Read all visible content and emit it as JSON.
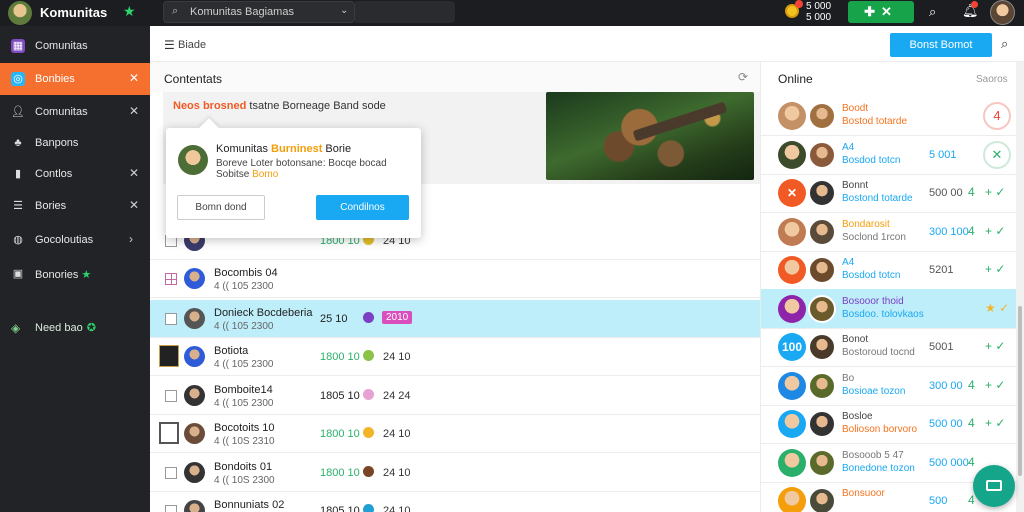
{
  "topbar": {
    "brand": "Komunitas",
    "search_text": "Komunitas Bagiamas",
    "coin_line1": "5 000",
    "coin_line2": "5 000",
    "game_button": "✕"
  },
  "sidebar": {
    "items": [
      {
        "label": "Comunitas",
        "icon": "grid-icon",
        "close": false
      },
      {
        "label": "Bonbies",
        "icon": "bell-icon",
        "close": true,
        "active": true
      },
      {
        "label": "Comunitas",
        "icon": "users-icon",
        "close": true
      },
      {
        "label": "Banpons",
        "icon": "group-icon",
        "close": false
      },
      {
        "label": "Contlos",
        "icon": "book-icon",
        "close": true
      },
      {
        "label": "Bories",
        "icon": "list-icon",
        "close": true
      },
      {
        "label": "Gocoloutias",
        "icon": "globe-icon",
        "close": true,
        "chevron": true
      },
      {
        "label": "Bonories",
        "icon": "box-icon",
        "close": false,
        "star": true
      }
    ],
    "footer": {
      "label": "Need bao",
      "icon": "shield-icon"
    }
  },
  "toolbar": {
    "menu_label": "Biade",
    "primary_button": "Bonst Bomot"
  },
  "content": {
    "title": "Contentats",
    "banner_highlight": "Neos brosned",
    "banner_text": " tsatne Borneage Band sode"
  },
  "popup": {
    "title_pre": "Komunitas ",
    "title_hl": "Burninest",
    "title_post": " Borie",
    "line1": "Boreve Loter botonsane: Bocqe bocad",
    "line2_pre": "Sobitse ",
    "line2_hl": "Bomo",
    "secondary": "Bomn dond",
    "primary": "Condilnos"
  },
  "rows": [
    {
      "name": "",
      "sub": "",
      "num": "1800 10",
      "num_color": "#2bb06b",
      "dot": "#e4c02a",
      "val": "24 10",
      "avatar": "#3b3b6b"
    },
    {
      "name": "Bocombis 04",
      "sub": "4 (( 105 2300",
      "num": "",
      "num_color": "#2bb06b",
      "dot": "",
      "val": "",
      "avatar": "#2f5bd8",
      "checkbox_style": "grid"
    },
    {
      "name": "Donieck Bocdeberia",
      "sub": "4 (( 105 2300",
      "num": "25 10",
      "num_color": "#222",
      "dot": "#7a3fc2",
      "pill": "2010",
      "avatar": "#555",
      "selected": true
    },
    {
      "name": "Botiota",
      "sub": "4 (( 105 2300",
      "num": "1800 10",
      "num_color": "#2bb06b",
      "dot": "#8bc34a",
      "val": "24 10",
      "avatar": "#2f5bd8",
      "checkbox_style": "dark"
    },
    {
      "name": "Bomboite14",
      "sub": "4 (( 105 2300",
      "num": "1805 10",
      "num_color": "#222",
      "dot": "#e7a1d3",
      "val": "24 24",
      "avatar": "#333"
    },
    {
      "name": "Bocotoits 10",
      "sub": "4 (( 10S 2310",
      "num": "1800 10",
      "num_color": "#2bb06b",
      "dot": "#f2b52a",
      "val": "24 10",
      "avatar": "#6b4b3a",
      "checkbox_style": "grey"
    },
    {
      "name": "Bondoits 01",
      "sub": "4 (( 10S 2300",
      "num": "1800 10",
      "num_color": "#2bb06b",
      "dot": "#7a4526",
      "val": "24 10",
      "avatar": "#333"
    },
    {
      "name": "Bonnuniats 02",
      "sub": "4 (( 105 2300",
      "num": "1805 10",
      "num_color": "#222",
      "dot": "#1f9fd3",
      "val": "24 10",
      "avatar": "#444"
    }
  ],
  "online": {
    "title": "Online",
    "right_label": "Saoros",
    "rows": [
      {
        "a1": "",
        "a1_color": "#c49066",
        "a2": "#a07040",
        "n1": "Boodt",
        "n1_color": "#f5731f",
        "n2": "Bostod totarde",
        "n2_color": "#f5731f",
        "num": "",
        "num_color": "#19a8f2",
        "ring": "4",
        "ring_color": "#f44336"
      },
      {
        "a1": "",
        "a1_color": "#3b4b2b",
        "a2": "#8a5a3a",
        "n1": "A4",
        "n1_color": "#19a8f2",
        "n2": "Bosdod totcn",
        "n2_color": "#19a8f2",
        "num": "5 001",
        "num_color": "#19a8f2",
        "ring": "✕",
        "ring_color": "#2bb06b"
      },
      {
        "a1": "✕",
        "a1_color": "#f15a24",
        "a2": "#333",
        "n1": "Bonnt",
        "n1_color": "#444",
        "n2": "Bostond totarde",
        "n2_color": "#19a8f2",
        "num": "500 00",
        "num_color": "#555",
        "act1": "4",
        "act2": "+ ✓"
      },
      {
        "a1": "",
        "a1_color": "#c07b52",
        "a2": "#5a4a3a",
        "n1": "Bondarosit",
        "n1_color": "#f59e0b",
        "n2": "Soclond 1rcon",
        "n2_color": "#777",
        "num": "300 100",
        "num_color": "#19a8f2",
        "act1": "4",
        "act2": "+ ✓"
      },
      {
        "a1": "",
        "a1_color": "#f15a24",
        "a2": "#6b4b2b",
        "n1": "A4",
        "n1_color": "#19a8f2",
        "n2": "Bosdod totcn",
        "n2_color": "#19a8f2",
        "num": "5201",
        "num_color": "#555",
        "act2": "+ ✓"
      },
      {
        "a1": "",
        "a1_color": "#8e24aa",
        "a2": "#6b5a2b",
        "n1": "Bosooor thoid",
        "n1_color": "#7a3fc2",
        "n2": "Bosdoo. tolovkaos",
        "n2_color": "#19a8f2",
        "num": "",
        "num_color": "#555",
        "act2": "★ ✓",
        "selected": true
      },
      {
        "a1": "100",
        "a1_color": "#19a8f2",
        "a2": "#4a3a2a",
        "n1": "Bonot",
        "n1_color": "#444",
        "n2": "Bostoroud tocnd",
        "n2_color": "#777",
        "num": "5001",
        "num_color": "#555",
        "act2": "+ ✓"
      },
      {
        "a1": "",
        "a1_color": "#1e88e5",
        "a2": "#5a6a2a",
        "n1": "Bo",
        "n1_color": "#777",
        "n2": "Bosioae tozon",
        "n2_color": "#19a8f2",
        "num": "300 00",
        "num_color": "#19a8f2",
        "act1": "4",
        "act2": "+ ✓"
      },
      {
        "a1": "",
        "a1_color": "#19a8f2",
        "a2": "#333",
        "n1": "Bosloe",
        "n1_color": "#444",
        "n2": "Bolioson borvoro",
        "n2_color": "#f5731f",
        "num": "500 00",
        "num_color": "#19a8f2",
        "act1": "4",
        "act2": "+ ✓"
      },
      {
        "a1": "",
        "a1_color": "#2bb06b",
        "a2": "#5a6a2a",
        "n1": "Bosooob 5 47",
        "n1_color": "#777",
        "n2": "Bonedone tozon",
        "n2_color": "#19a8f2",
        "num": "500 000",
        "num_color": "#19a8f2",
        "act1": "4"
      },
      {
        "a1": "",
        "a1_color": "#f59e0b",
        "a2": "#4a4a3a",
        "n1": "Bonsuoor",
        "n1_color": "#f5731f",
        "n2": "",
        "n2_color": "#777",
        "num": "500",
        "num_color": "#19a8f2",
        "act1": "4"
      }
    ]
  }
}
